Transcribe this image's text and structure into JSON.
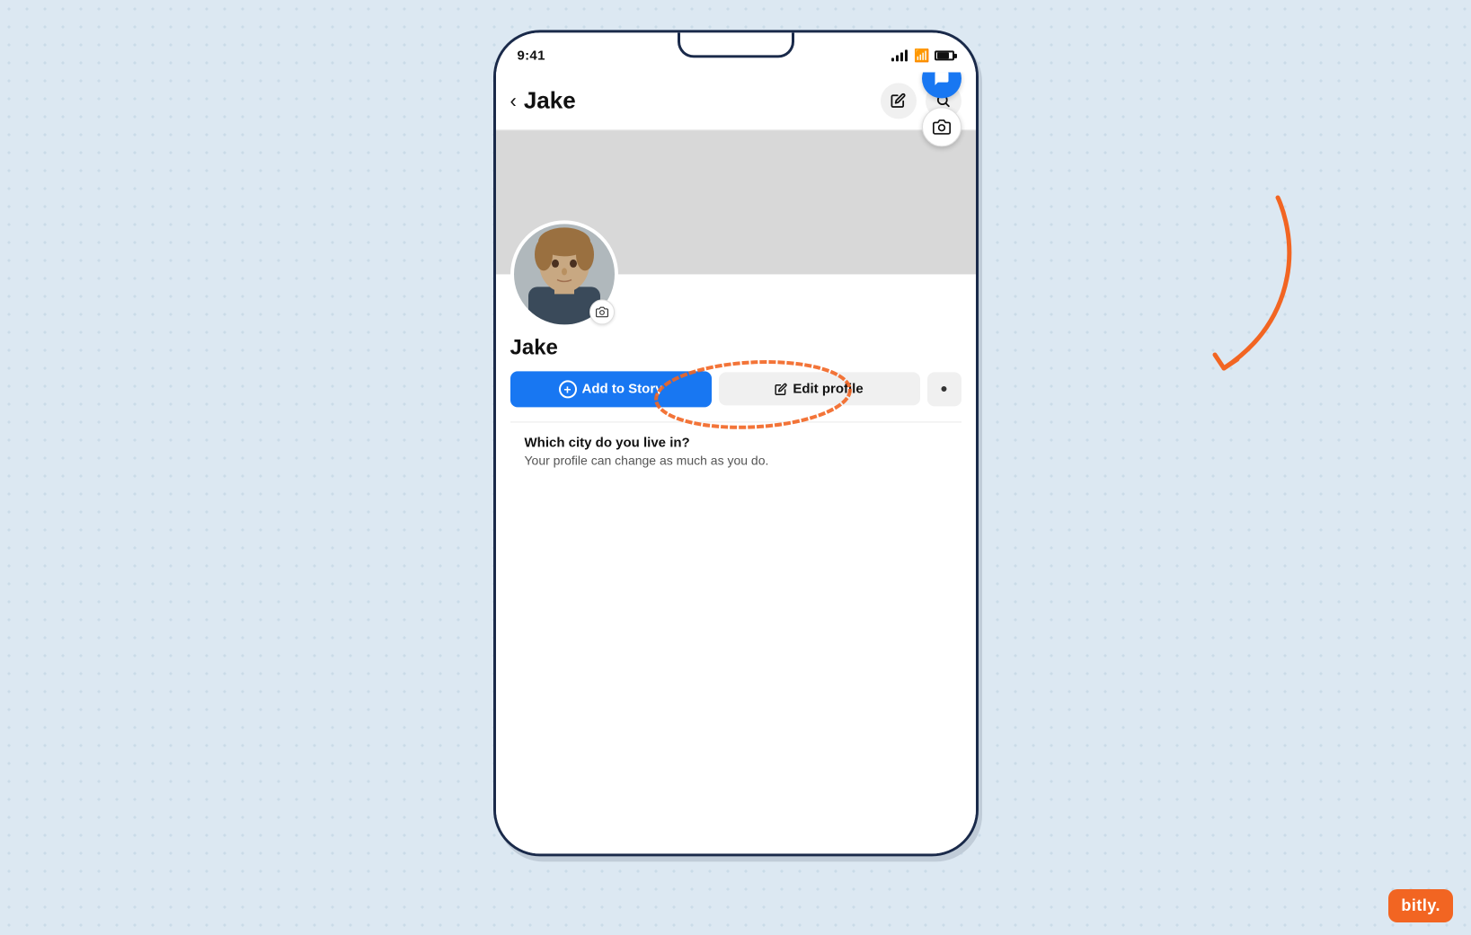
{
  "background": {
    "color": "#e8f0f7"
  },
  "status_bar": {
    "time": "9:41",
    "signal": "signal",
    "wifi": "wifi",
    "battery": "battery"
  },
  "header": {
    "back_label": "‹",
    "title": "Jake",
    "edit_btn_label": "✏",
    "search_btn_label": "🔍"
  },
  "profile": {
    "name": "Jake",
    "avatar_alt": "Jake profile photo"
  },
  "buttons": {
    "add_to_story": "Add to Story",
    "add_to_story_icon": "+",
    "edit_profile": "Edit profile",
    "edit_icon": "✏",
    "more": "•"
  },
  "city_section": {
    "question": "Which city do you live in?",
    "description": "Your profile can change as much as you do."
  },
  "bitly": {
    "label": "bitly."
  },
  "floating_btns": {
    "message_icon": "💬",
    "camera_icon": "📷"
  }
}
